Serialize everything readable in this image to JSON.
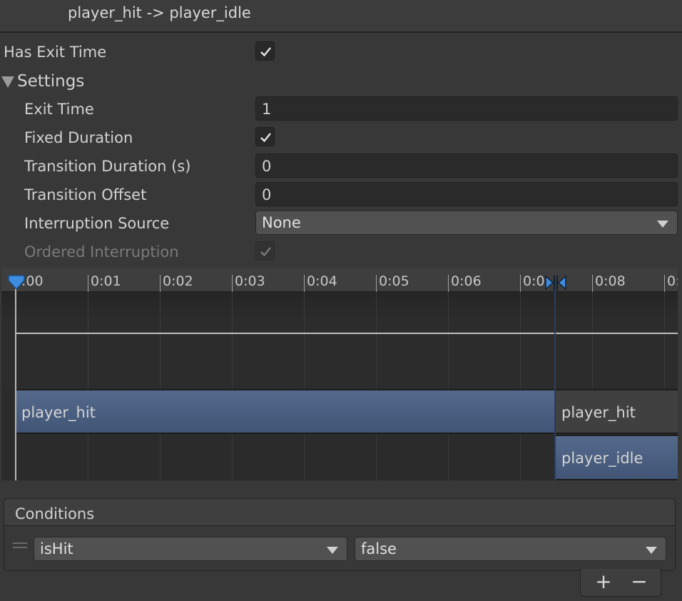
{
  "header": {
    "title": "player_hit -> player_idle"
  },
  "has_exit_time": {
    "label": "Has Exit Time",
    "checked": true
  },
  "settings": {
    "label": "Settings",
    "exit_time": {
      "label": "Exit Time",
      "value": "1"
    },
    "fixed_duration": {
      "label": "Fixed Duration",
      "checked": true
    },
    "transition_duration": {
      "label": "Transition Duration (s)",
      "value": "0"
    },
    "transition_offset": {
      "label": "Transition Offset",
      "value": "0"
    },
    "interruption_source": {
      "label": "Interruption Source",
      "value": "None"
    },
    "ordered_interruption": {
      "label": "Ordered Interruption",
      "checked": true,
      "enabled": false
    }
  },
  "timeline": {
    "ticks": [
      ":00",
      "0:01",
      "0:02",
      "0:03",
      "0:04",
      "0:05",
      "0:06",
      "0:0",
      "0:08",
      "0:"
    ],
    "source_clip": "player_hit",
    "source_clip_tail": "player_hit",
    "destination_clip": "player_idle"
  },
  "conditions": {
    "title": "Conditions",
    "items": [
      {
        "parameter": "isHit",
        "value": "false"
      }
    ],
    "add_label": "+",
    "remove_label": "−"
  },
  "colors": {
    "clip_blue": "#4a5f82",
    "handle_blue": "#3f8de0"
  }
}
